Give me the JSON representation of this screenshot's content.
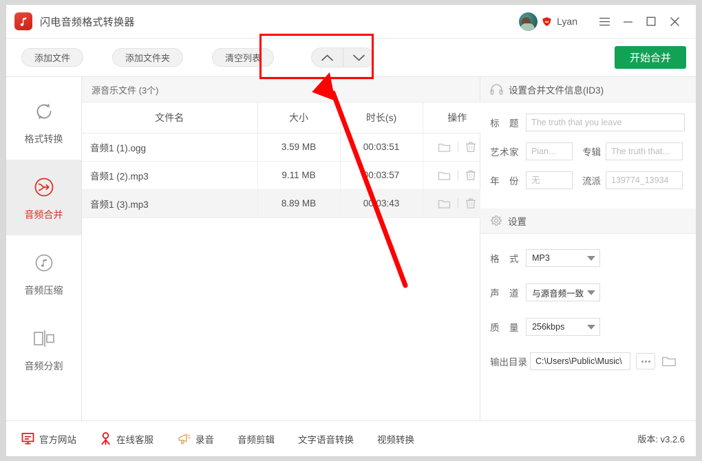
{
  "window": {
    "app_title": "闪电音频格式转换器",
    "logo_icon": "music-note-logo",
    "user": {
      "name": "Lyan",
      "badge_icon": "vip-shield-icon",
      "avatar_icon": "user-avatar"
    },
    "controls": {
      "menu_icon": "hamburger-menu-icon",
      "minimize_icon": "minimize-icon",
      "maximize_icon": "maximize-icon",
      "close_icon": "close-icon"
    }
  },
  "toolbar": {
    "add_file": "添加文件",
    "add_folder": "添加文件夹",
    "clear_list": "清空列表",
    "move_up_icon": "chevron-up-icon",
    "move_down_icon": "chevron-down-icon",
    "start_button": "开始合并"
  },
  "sidebar": {
    "items": [
      {
        "label": "格式转换",
        "icon": "refresh-convert-icon",
        "active": false
      },
      {
        "label": "音频合并",
        "icon": "merge-arrow-icon",
        "active": true
      },
      {
        "label": "音频压缩",
        "icon": "music-note-circle-icon",
        "active": false
      },
      {
        "label": "音频分割",
        "icon": "split-icon",
        "active": false
      }
    ]
  },
  "file_list": {
    "header": "源音乐文件 (3个)",
    "columns": [
      "文件名",
      "大小",
      "时长(s)",
      "操作"
    ],
    "row_actions": {
      "open_folder_icon": "folder-icon",
      "delete_icon": "trash-icon"
    },
    "rows": [
      {
        "name": "音频1 (1).ogg",
        "size": "3.59 MB",
        "duration": "00:03:51",
        "selected": false
      },
      {
        "name": "音频1 (2).mp3",
        "size": "9.11 MB",
        "duration": "00:03:57",
        "selected": false
      },
      {
        "name": "音频1 (3).mp3",
        "size": "8.89 MB",
        "duration": "00:03:43",
        "selected": true
      }
    ]
  },
  "id3_panel": {
    "title": "设置合并文件信息(ID3)",
    "icon": "headphones-icon",
    "fields": {
      "title_label": "标　题",
      "title_placeholder": "The truth that you leave",
      "title_value": "",
      "artist_label": "艺术家",
      "artist_placeholder": "Pian...",
      "artist_value": "",
      "album_label": "专辑",
      "album_placeholder": "The truth that...",
      "album_value": "",
      "year_label": "年　份",
      "year_placeholder": "无",
      "year_value": "",
      "genre_label": "流派",
      "genre_placeholder": "139774_13934",
      "genre_value": ""
    }
  },
  "settings_panel": {
    "title": "设置",
    "icon": "gear-icon",
    "format_label": "格　式",
    "format_value": "MP3",
    "channel_label": "声　道",
    "channel_value": "与源音频一致",
    "quality_label": "质　量",
    "quality_value": "256kbps",
    "output_label": "输出目录",
    "output_value": "C:\\Users\\Public\\Music\\",
    "browse_icon": "ellipsis-browse-icon",
    "open_folder_icon": "open-folder-icon"
  },
  "bottom_bar": {
    "items": [
      {
        "label": "官方网站",
        "icon": "monitor-website-icon"
      },
      {
        "label": "在线客服",
        "icon": "person-support-icon"
      },
      {
        "label": "录音",
        "icon": "megaphone-record-icon"
      },
      {
        "label": "音频剪辑",
        "icon": ""
      },
      {
        "label": "文字语音转换",
        "icon": ""
      },
      {
        "label": "视频转换",
        "icon": ""
      }
    ],
    "version": "版本:  v3.2.6"
  },
  "annotations": {
    "highlight_rect": "red-highlight-rectangle",
    "pointer_arrow": "red-pointer-arrow"
  },
  "colors": {
    "accent_red": "#e03127",
    "start_green": "#13a155",
    "annotation_red": "#ff0000"
  }
}
